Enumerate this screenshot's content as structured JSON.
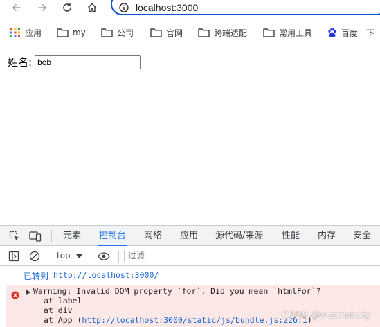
{
  "browser": {
    "url": "localhost:3000",
    "icons": [
      "back-icon",
      "forward-icon",
      "reload-icon",
      "home-icon",
      "info-icon"
    ]
  },
  "bookmarks": [
    {
      "label": "应用",
      "icon": "apps-grid-icon"
    },
    {
      "label": "my",
      "icon": "folder-icon"
    },
    {
      "label": "公司",
      "icon": "folder-icon"
    },
    {
      "label": "官网",
      "icon": "folder-icon"
    },
    {
      "label": "跨端适配",
      "icon": "folder-icon"
    },
    {
      "label": "常用工具",
      "icon": "folder-icon"
    },
    {
      "label": "百度一下",
      "icon": "baidu-paw-icon"
    }
  ],
  "page": {
    "name_label": "姓名:",
    "name_value": "bob"
  },
  "devtools": {
    "tabs": [
      "元素",
      "控制台",
      "网络",
      "应用",
      "源代码/来源",
      "性能",
      "内存",
      "安全"
    ],
    "active_tab": "控制台",
    "context": "top",
    "filter_placeholder": "过滤",
    "console": {
      "nav_label": "已转到",
      "nav_url": "http://localhost:3000/",
      "warning_text": "Warning: Invalid DOM property `for`. Did you mean `htmlFor`?",
      "stack": [
        "at label",
        "at div"
      ],
      "app_prefix": "at App (",
      "app_link": "http://localhost:3000/static/js/bundle.js:226:1",
      "app_suffix": ")"
    }
  },
  "watermark": "CSDN @w-somebody",
  "colors": {
    "accent": "#1a73e8",
    "omnibox_border": "#0b57d0",
    "error_bg": "#fce8e6",
    "error_red": "#d93025"
  }
}
